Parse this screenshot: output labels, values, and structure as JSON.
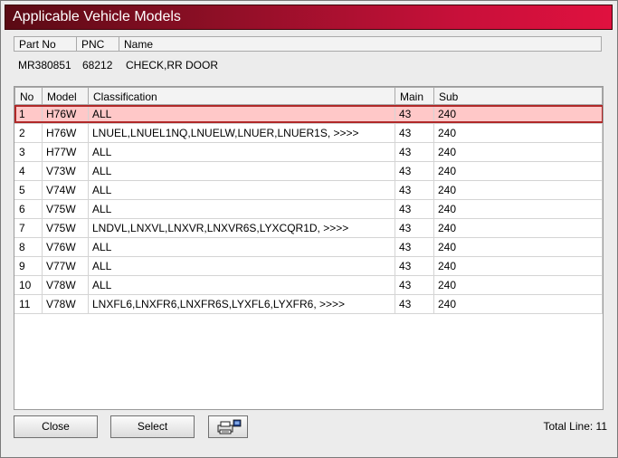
{
  "window": {
    "title": "Applicable Vehicle Models"
  },
  "part": {
    "headers": {
      "part_no": "Part No",
      "pnc": "PNC",
      "name": "Name"
    },
    "values": {
      "part_no": "MR380851",
      "pnc": "68212",
      "name": "CHECK,RR DOOR"
    }
  },
  "table": {
    "columns": {
      "no": "No",
      "model": "Model",
      "classification": "Classification",
      "main": "Main",
      "sub": "Sub"
    },
    "rows": [
      {
        "no": "1",
        "model": "H76W",
        "classification": "ALL",
        "main": "43",
        "sub": "240"
      },
      {
        "no": "2",
        "model": "H76W",
        "classification": "LNUEL,LNUEL1NQ,LNUELW,LNUER,LNUER1S,  >>>>",
        "main": "43",
        "sub": "240"
      },
      {
        "no": "3",
        "model": "H77W",
        "classification": "ALL",
        "main": "43",
        "sub": "240"
      },
      {
        "no": "4",
        "model": "V73W",
        "classification": "ALL",
        "main": "43",
        "sub": "240"
      },
      {
        "no": "5",
        "model": "V74W",
        "classification": "ALL",
        "main": "43",
        "sub": "240"
      },
      {
        "no": "6",
        "model": "V75W",
        "classification": "ALL",
        "main": "43",
        "sub": "240"
      },
      {
        "no": "7",
        "model": "V75W",
        "classification": "LNDVL,LNXVL,LNXVR,LNXVR6S,LYXCQR1D,  >>>>",
        "main": "43",
        "sub": "240"
      },
      {
        "no": "8",
        "model": "V76W",
        "classification": "ALL",
        "main": "43",
        "sub": "240"
      },
      {
        "no": "9",
        "model": "V77W",
        "classification": "ALL",
        "main": "43",
        "sub": "240"
      },
      {
        "no": "10",
        "model": "V78W",
        "classification": "ALL",
        "main": "43",
        "sub": "240"
      },
      {
        "no": "11",
        "model": "V78W",
        "classification": "LNXFL6,LNXFR6,LNXFR6S,LYXFL6,LYXFR6,  >>>>",
        "main": "43",
        "sub": "240"
      }
    ],
    "selected_row": 1
  },
  "buttons": {
    "close": "Close",
    "select": "Select",
    "print_icon": "printer-icon"
  },
  "footer": {
    "total_line": "Total Line: 11"
  },
  "colors": {
    "title_start": "#5a0a14",
    "title_end": "#e0113f",
    "selection_fill": "#ffc8c8",
    "selection_border": "#b02828"
  }
}
